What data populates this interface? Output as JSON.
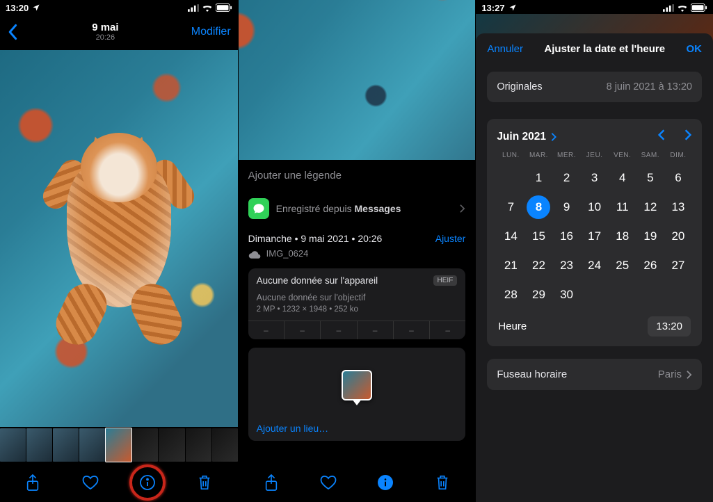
{
  "status": {
    "time_s1": "13:20",
    "time_s3": "13:27"
  },
  "screen1": {
    "nav": {
      "date": "9 mai",
      "time": "20:26",
      "edit": "Modifier"
    }
  },
  "screen2": {
    "caption_placeholder": "Ajouter une légende",
    "source_prefix": "Enregistré depuis ",
    "source_app": "Messages",
    "meta": {
      "date_line": "Dimanche  •  9 mai 2021  •  20:26",
      "adjust": "Ajuster",
      "filename": "IMG_0624"
    },
    "info_card": {
      "device_missing": "Aucune donnée sur l'appareil",
      "format_badge": "HEIF",
      "lens_missing": "Aucune donnée sur l'objectif",
      "mp": "2 MP",
      "dims": "1232 × 1948",
      "size": "252 ko",
      "exif": [
        "–",
        "–",
        "–",
        "–",
        "–",
        "–"
      ]
    },
    "map": {
      "add_location": "Ajouter un lieu…"
    }
  },
  "screen3": {
    "sheet": {
      "cancel": "Annuler",
      "title": "Ajuster la date et l'heure",
      "ok": "OK"
    },
    "originals": {
      "label": "Originales",
      "value": "8 juin 2021 à 13:20"
    },
    "calendar": {
      "month_label": "Juin 2021",
      "dow": [
        "LUN.",
        "MAR.",
        "MER.",
        "JEU.",
        "VEN.",
        "SAM.",
        "DIM."
      ],
      "leading_blanks": 1,
      "days_in_month": 30,
      "selected_day": 8
    },
    "time": {
      "label": "Heure",
      "value": "13:20"
    },
    "tz": {
      "label": "Fuseau horaire",
      "value": "Paris"
    }
  }
}
